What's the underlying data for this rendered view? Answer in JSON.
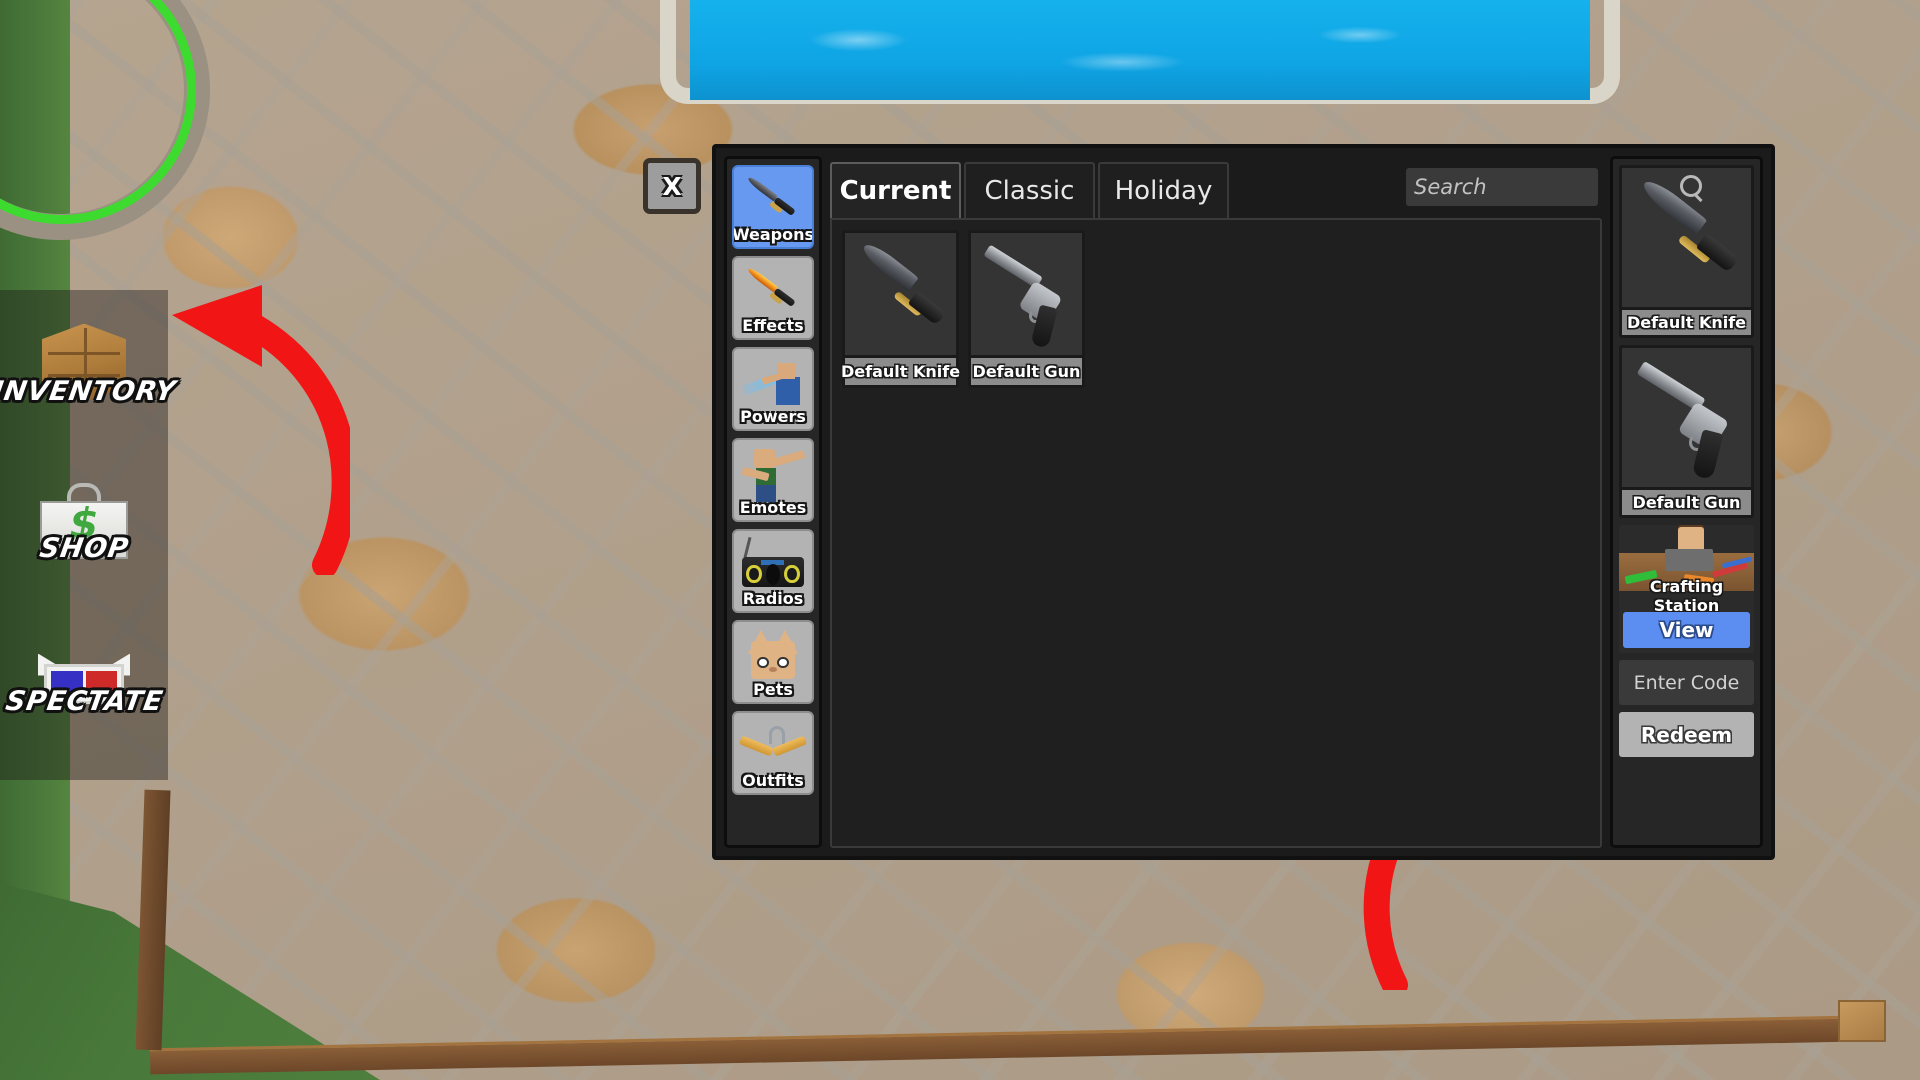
{
  "hud": {
    "buttons": [
      {
        "label": "INVENTORY",
        "icon": "crate-icon"
      },
      {
        "label": "SHOP",
        "icon": "briefcase-dollar-icon"
      },
      {
        "label": "SPECTATE",
        "icon": "3d-glasses-icon"
      }
    ]
  },
  "window": {
    "close_label": "X",
    "categories": [
      {
        "label": "Weapons",
        "icon": "knife-icon",
        "active": true
      },
      {
        "label": "Effects",
        "icon": "flaming-knife-icon",
        "active": false
      },
      {
        "label": "Powers",
        "icon": "ice-power-icon",
        "active": false
      },
      {
        "label": "Emotes",
        "icon": "dab-emote-icon",
        "active": false
      },
      {
        "label": "Radios",
        "icon": "boombox-icon",
        "active": false
      },
      {
        "label": "Pets",
        "icon": "cat-head-icon",
        "active": false
      },
      {
        "label": "Outfits",
        "icon": "clothes-hanger-icon",
        "active": false
      }
    ],
    "tabs": [
      {
        "label": "Current",
        "active": true
      },
      {
        "label": "Classic",
        "active": false
      },
      {
        "label": "Holiday",
        "active": false
      }
    ],
    "search": {
      "value": "",
      "placeholder": "Search",
      "icon": "search-icon"
    },
    "items": [
      {
        "name": "Default Knife",
        "art": "knife"
      },
      {
        "name": "Default Gun",
        "art": "gun"
      }
    ]
  },
  "right_panel": {
    "equipped": [
      {
        "name": "Default Knife",
        "art": "knife"
      },
      {
        "name": "Default Gun",
        "art": "gun"
      }
    ],
    "crafting": {
      "title": "Crafting Station",
      "view_label": "View"
    },
    "code": {
      "placeholder": "Enter Code",
      "value": "",
      "redeem_label": "Redeem"
    }
  },
  "colors": {
    "accent_blue": "#5b8ef0",
    "panel_dark": "#1f1f1f",
    "sidebar_gray": "#b3b3b3",
    "arrow_red": "#f21515"
  }
}
